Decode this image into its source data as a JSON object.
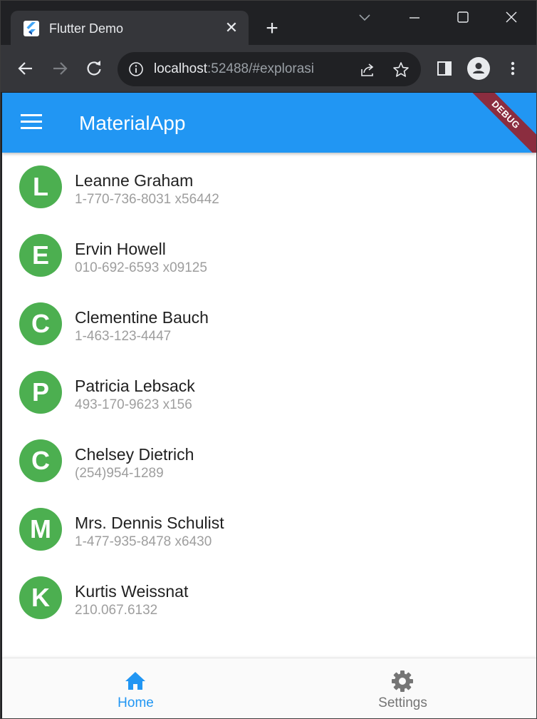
{
  "browser": {
    "tab_title": "Flutter Demo",
    "tab_close_glyph": "✕",
    "new_tab_glyph": "+",
    "url_host": "localhost",
    "url_rest": ":52488/#explorasi"
  },
  "app": {
    "title": "MaterialApp",
    "debug_label": "DEBUG",
    "colors": {
      "appbar": "#2196f3",
      "avatar": "#4caf50",
      "nav_active": "#2196f3",
      "nav_inactive": "#757575"
    },
    "contacts": [
      {
        "initial": "L",
        "name": "Leanne Graham",
        "phone": "1-770-736-8031 x56442"
      },
      {
        "initial": "E",
        "name": "Ervin Howell",
        "phone": "010-692-6593 x09125"
      },
      {
        "initial": "C",
        "name": "Clementine Bauch",
        "phone": "1-463-123-4447"
      },
      {
        "initial": "P",
        "name": "Patricia Lebsack",
        "phone": "493-170-9623 x156"
      },
      {
        "initial": "C",
        "name": "Chelsey Dietrich",
        "phone": "(254)954-1289"
      },
      {
        "initial": "M",
        "name": "Mrs. Dennis Schulist",
        "phone": "1-477-935-8478 x6430"
      },
      {
        "initial": "K",
        "name": "Kurtis Weissnat",
        "phone": "210.067.6132"
      }
    ],
    "bottom_nav": {
      "home_label": "Home",
      "settings_label": "Settings",
      "active": "Home"
    }
  }
}
